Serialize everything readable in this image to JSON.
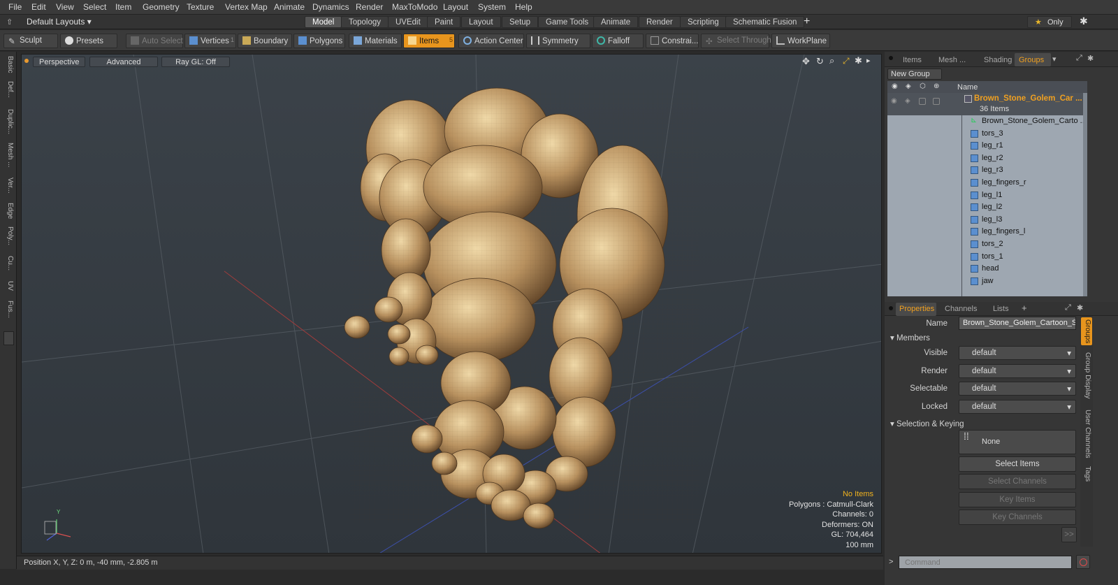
{
  "menu": [
    "File",
    "Edit",
    "View",
    "Select",
    "Item",
    "Geometry",
    "Texture",
    "Vertex Map",
    "Animate",
    "Dynamics",
    "Render",
    "MaxToModo",
    "Layout",
    "System",
    "Help"
  ],
  "layout_selector": "Default Layouts",
  "layout_tabs": [
    "Model",
    "Topology",
    "UVEdit",
    "Paint",
    "Layout",
    "Setup",
    "Game Tools",
    "Animate",
    "Render",
    "Scripting",
    "Schematic Fusion"
  ],
  "active_layout_tab": "Model",
  "only_label": "Only",
  "toolbar": {
    "sculpt": "Sculpt",
    "presets": "Presets",
    "auto_select": "Auto Select",
    "vertices": "Vertices",
    "vertices_count": "1",
    "boundary": "Boundary",
    "polygons": "Polygons",
    "materials": "Materials",
    "items": "Items",
    "items_count": "5",
    "action_center": "Action Center",
    "symmetry": "Symmetry",
    "falloff": "Falloff",
    "constraints": "Constrai...",
    "select_through": "Select Through",
    "workplane": "WorkPlane"
  },
  "left_tabs": [
    "Basic",
    "Def...",
    "Duplic...",
    "Mesh ...",
    "Ver...",
    "Edge",
    "Poly...",
    "Cu...",
    "UV",
    "Fus..."
  ],
  "viewport": {
    "perspective": "Perspective",
    "advanced": "Advanced",
    "raygl": "Ray GL: Off",
    "info": {
      "selection": "No Items",
      "polygons": "Polygons : Catmull-Clark",
      "channels": "Channels: 0",
      "deformers": "Deformers: ON",
      "gl": "GL: 704,464",
      "scale": "100 mm"
    },
    "axis_y": "Y"
  },
  "status": "Position X, Y, Z:  0 m, -40 mm, -2.805 m",
  "panel_tabs": [
    "Items",
    "Mesh ...",
    "Shading",
    "Groups"
  ],
  "active_panel_tab": "Groups",
  "new_group": "New Group",
  "list_header": "Name",
  "group": {
    "name": "Brown_Stone_Golem_Car ...",
    "count": "36 Items"
  },
  "items": [
    "Brown_Stone_Golem_Carto ...",
    "tors_3",
    "leg_r1",
    "leg_r2",
    "leg_r3",
    "leg_fingers_r",
    "leg_l1",
    "leg_l2",
    "leg_l3",
    "leg_fingers_l",
    "tors_2",
    "tors_1",
    "head",
    "jaw"
  ],
  "prop_tabs": [
    "Properties",
    "Channels",
    "Lists"
  ],
  "props": {
    "name_label": "Name",
    "name_value": "Brown_Stone_Golem_Cartoon_St",
    "members": "Members",
    "visible_label": "Visible",
    "visible": "default",
    "render_label": "Render",
    "render": "default",
    "selectable_label": "Selectable",
    "selectable": "default",
    "locked_label": "Locked",
    "locked": "default",
    "sel_keying": "Selection & Keying",
    "none": "None",
    "select_items": "Select Items",
    "select_channels": "Select Channels",
    "key_items": "Key Items",
    "key_channels": "Key Channels",
    "more": ">>"
  },
  "right_vtabs": [
    "Groups",
    "Group Display",
    "User Channels",
    "Tags"
  ],
  "command_placeholder": "Command",
  "colors": {
    "accent": "#e8951d",
    "group_name": "#f0a020",
    "list_bg": "#9ea7b1"
  }
}
